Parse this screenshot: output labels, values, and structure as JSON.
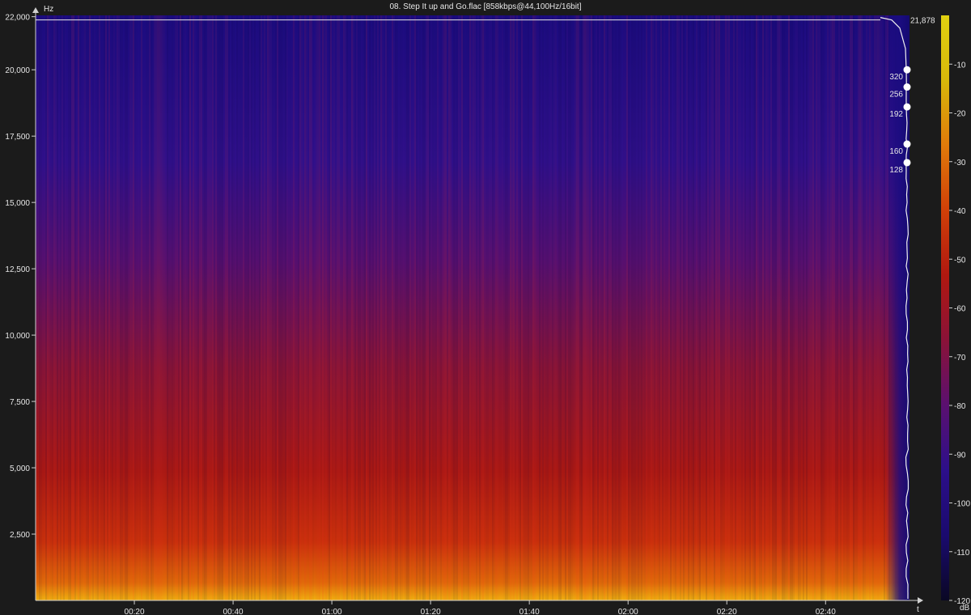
{
  "title": "08. Step It up and Go.flac [858kbps@44,100Hz/16bit]",
  "chart_data": {
    "type": "heatmap",
    "title": "08. Step It up and Go.flac [858kbps@44,100Hz/16bit]",
    "xlabel": "t",
    "ylabel": "Hz",
    "x_ticks": [
      "00:20",
      "00:40",
      "01:00",
      "01:20",
      "01:40",
      "02:00",
      "02:20",
      "02:40"
    ],
    "x_tick_values_sec": [
      20,
      40,
      60,
      80,
      100,
      120,
      140,
      160
    ],
    "xlim_sec": [
      0,
      177
    ],
    "y_ticks": [
      "22,000",
      "20,000",
      "17,500",
      "15,000",
      "12,500",
      "10,000",
      "7,500",
      "5,000",
      "2,500"
    ],
    "y_tick_values": [
      22000,
      20000,
      17500,
      15000,
      12500,
      10000,
      7500,
      5000,
      2500
    ],
    "ylim": [
      0,
      22050
    ],
    "cutoff_frequency_label": "21,878",
    "cutoff_frequency_hz": 21878,
    "bitrate_markers": [
      {
        "label": "320",
        "freq": 20000
      },
      {
        "label": "256",
        "freq": 19350
      },
      {
        "label": "192",
        "freq": 18600
      },
      {
        "label": "160",
        "freq": 17200
      },
      {
        "label": "128",
        "freq": 16500
      }
    ],
    "colorbar": {
      "label": "dB",
      "ticks": [
        "-10",
        "-20",
        "-30",
        "-40",
        "-50",
        "-60",
        "-70",
        "-80",
        "-90",
        "-100",
        "-110",
        "-120"
      ],
      "tick_values": [
        -10,
        -20,
        -30,
        -40,
        -50,
        -60,
        -70,
        -80,
        -90,
        -100,
        -110,
        -120
      ],
      "range": [
        -120,
        0
      ],
      "colors": [
        "#0a0824",
        "#1a0a6e",
        "#2c0f8a",
        "#5a1070",
        "#8a1238",
        "#b01810",
        "#d04008",
        "#e07a0a",
        "#d8b80a",
        "#e0d010"
      ]
    },
    "grid": false,
    "legend": "colorbar-right"
  }
}
